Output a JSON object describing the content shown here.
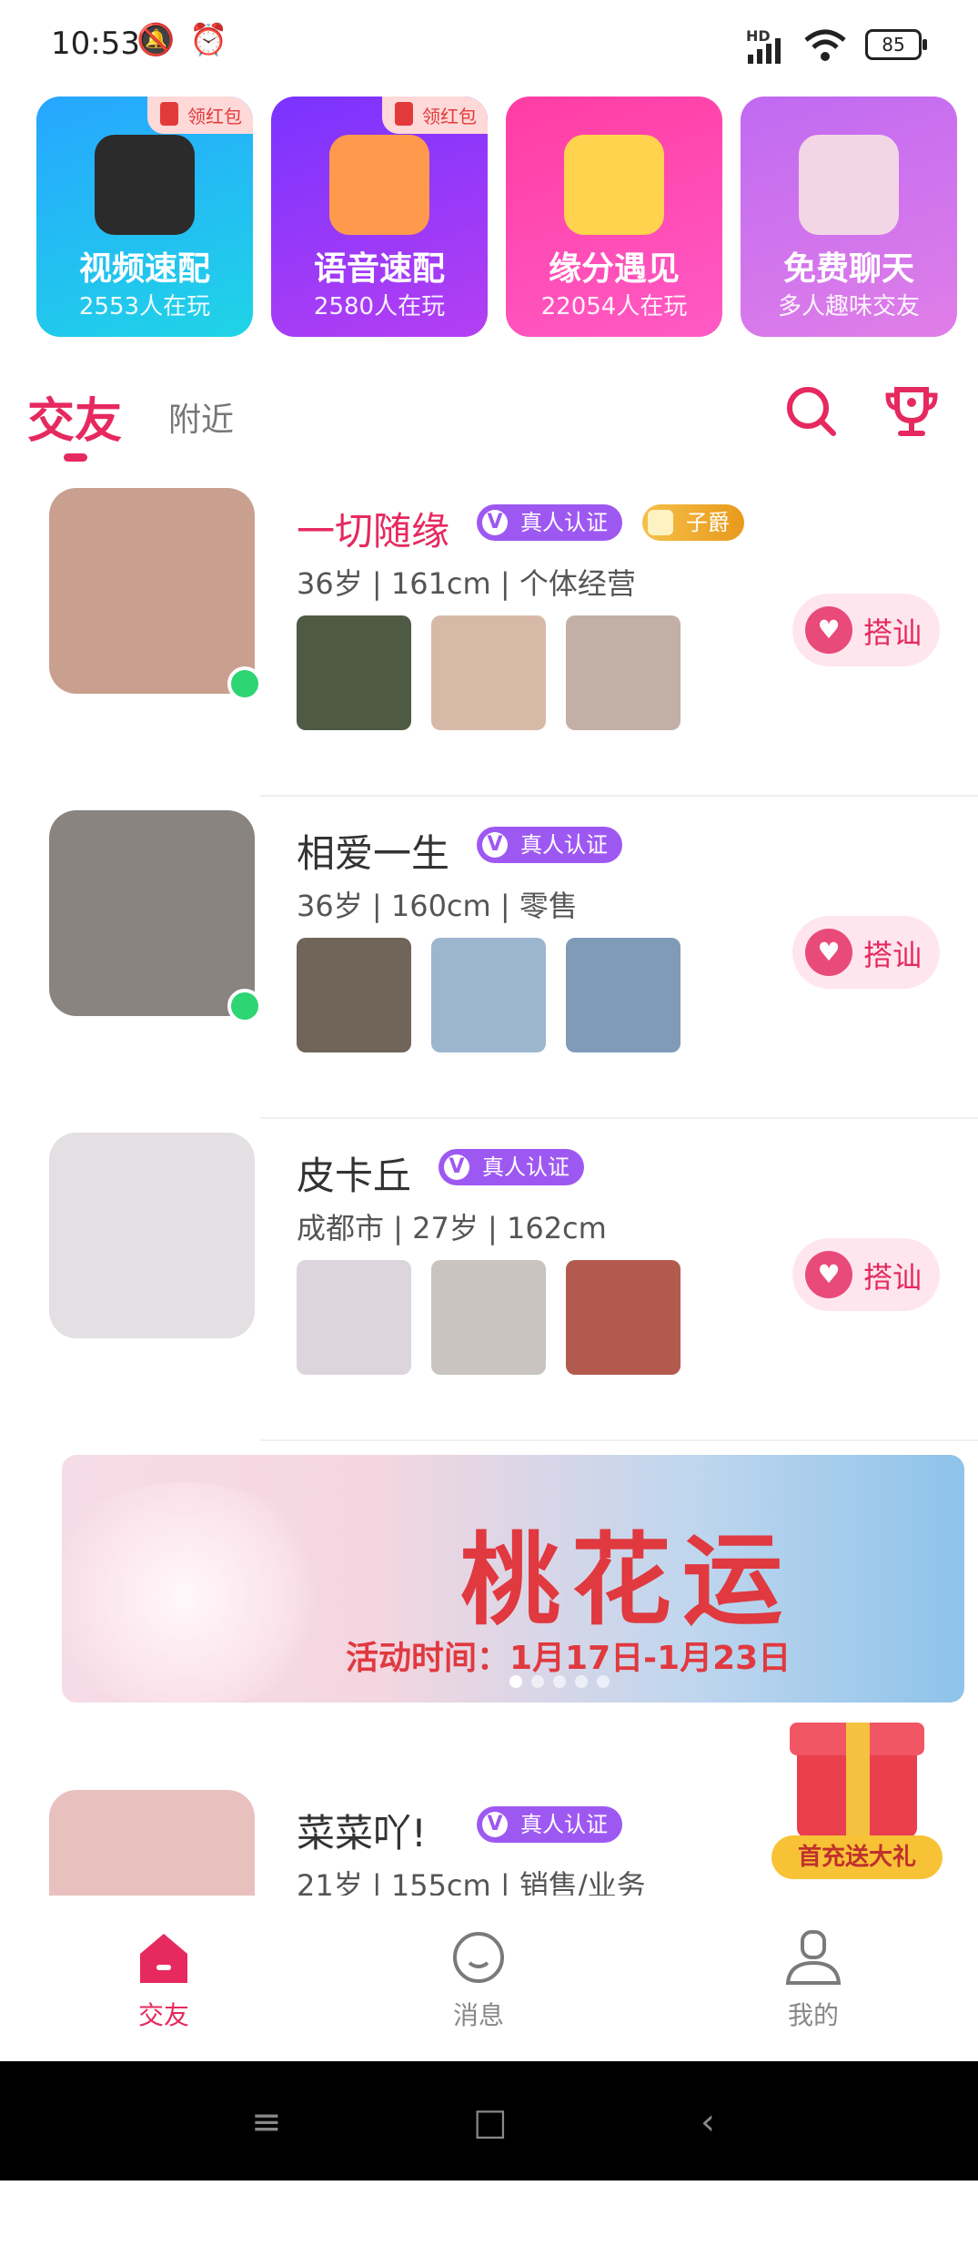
{
  "status_bar": {
    "time": "10:53",
    "network": "HD",
    "battery": "85"
  },
  "feature_cards": [
    {
      "title": "视频速配",
      "subtitle": "2553人在玩",
      "badge": "领红包",
      "gradient": "linear-gradient(160deg,#27a6ff,#1fd4e6)"
    },
    {
      "title": "语音速配",
      "subtitle": "2580人在玩",
      "badge": "领红包",
      "gradient": "linear-gradient(160deg,#7a33ff,#b43ff2)"
    },
    {
      "title": "缘分遇见",
      "subtitle": "22054人在玩",
      "badge": "",
      "gradient": "linear-gradient(160deg,#ff3da3,#ff5ac5)"
    },
    {
      "title": "免费聊天",
      "subtitle": "多人趣味交友",
      "badge": "",
      "gradient": "linear-gradient(160deg,#c06af2,#e07ee8)"
    }
  ],
  "tabs": {
    "active": "交友",
    "inactive": "附近"
  },
  "users": [
    {
      "name": "一切随缘",
      "verify": "真人认证",
      "rank": "子爵",
      "meta": "36岁 | 161cm | 个体经营",
      "greet": "搭讪",
      "online": true,
      "vip": true,
      "avatar_color": "#c9a08f",
      "photo_colors": [
        "#4f5a44",
        "#d7b9a8",
        "#c2b0a6"
      ]
    },
    {
      "name": "相爱一生",
      "verify": "真人认证",
      "rank": "",
      "meta": "36岁 | 160cm | 零售",
      "greet": "搭讪",
      "online": true,
      "vip": false,
      "avatar_color": "#8a8480",
      "photo_colors": [
        "#6f6558",
        "#9cb6cf",
        "#7f9bb8"
      ]
    },
    {
      "name": "皮卡丘",
      "verify": "真人认证",
      "rank": "",
      "meta": "成都市 | 27岁 | 162cm",
      "greet": "搭讪",
      "online": false,
      "vip": false,
      "avatar_color": "#e3dfe2",
      "photo_colors": [
        "#dcd6dc",
        "#c9c4c0",
        "#b35a4f"
      ]
    },
    {
      "name": "菜菜吖!",
      "verify": "真人认证",
      "rank": "",
      "meta": "21岁 | 155cm | 销售/业务",
      "greet": "搭讪",
      "online": false,
      "vip": false,
      "avatar_color": "#e8c1bf",
      "photo_colors": []
    }
  ],
  "banner": {
    "title": "桃花运",
    "time": "活动时间：1月17日-1月23日",
    "dots": 5,
    "active_dot": 0
  },
  "gift": {
    "label": "首充送大礼"
  },
  "bottom_nav": [
    {
      "label": "交友",
      "icon": "home-icon",
      "active": true
    },
    {
      "label": "消息",
      "icon": "message-icon",
      "active": false
    },
    {
      "label": "我的",
      "icon": "profile-icon",
      "active": false
    }
  ],
  "system_nav": {
    "menu": "≡",
    "home": "□",
    "back": "‹"
  },
  "colors": {
    "accent": "#e6295f",
    "verify": "#9e58f2",
    "online": "#2ed573"
  }
}
